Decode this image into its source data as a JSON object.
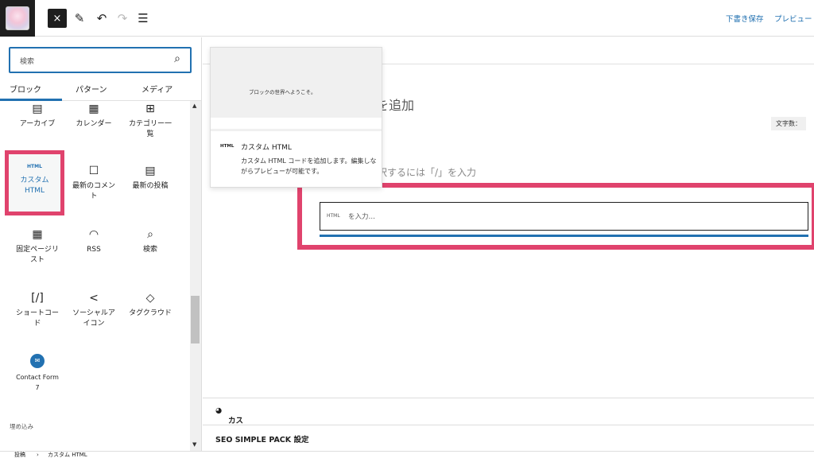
{
  "topbar": {
    "close_icon": "×",
    "edit_icon": "✎",
    "undo_icon": "↶",
    "redo_icon": "↷",
    "list_view_icon": "☰",
    "save_draft": "下書き保存",
    "preview": "プレビュー"
  },
  "inserter": {
    "search_placeholder": "検索",
    "search_icon": "⌕",
    "tabs": [
      "ブロック",
      "パターン",
      "メディア"
    ],
    "blocks": {
      "archive": {
        "icon": "▤",
        "label": "アーカイブ"
      },
      "calendar": {
        "icon": "▦",
        "label": "カレンダー"
      },
      "category": {
        "icon": "⊞",
        "label_1": "カテゴリー一",
        "label_2": "覧"
      },
      "custom_html": {
        "icon": "HTML",
        "label_1": "カスタム",
        "label_2": "HTML"
      },
      "latest_comments": {
        "icon": "☐",
        "label_1": "最新のコメン",
        "label_2": "ト"
      },
      "latest_posts": {
        "icon": "▤",
        "label": "最新の投稿"
      },
      "page_list": {
        "icon": "▦",
        "label_1": "固定ページリ",
        "label_2": "スト"
      },
      "rss": {
        "icon": "◠",
        "label": "RSS"
      },
      "search": {
        "icon": "⌕",
        "label": "検索"
      },
      "shortcode": {
        "icon": "[/]",
        "label_1": "ショートコー",
        "label_2": "ド"
      },
      "social_icons": {
        "icon": "<",
        "label_1": "ソーシャルア",
        "label_2": "イコン"
      },
      "tag_cloud": {
        "icon": "◇",
        "label": "タグクラウド"
      },
      "contact_form": {
        "icon": "✉",
        "label_1": "Contact Form",
        "label_2": "7"
      }
    },
    "embed_label": "埋め込み"
  },
  "editor": {
    "heading_fragment": "を追加",
    "word_count": "文字数：",
    "hint": "択するには「/」を入力",
    "html_tag": "HTML",
    "html_placeholder": "を入力…",
    "meta_custom_css_js": "カスタムCSS & JS",
    "meta_seo": "SEO SIMPLE PACK 設定"
  },
  "preview_popover": {
    "welcome": "ブロックの世界へようこそ。",
    "tag": "HTML",
    "title": "カスタム HTML",
    "description": "カスタム HTML コードを追加します。編集しながらプレビューが可能です。"
  },
  "footer": {
    "breadcrumb_1": "投稿",
    "separator": "›",
    "breadcrumb_2": "カスタム HTML"
  },
  "colors": {
    "accent": "#2271b1",
    "highlight": "#e0436d"
  }
}
